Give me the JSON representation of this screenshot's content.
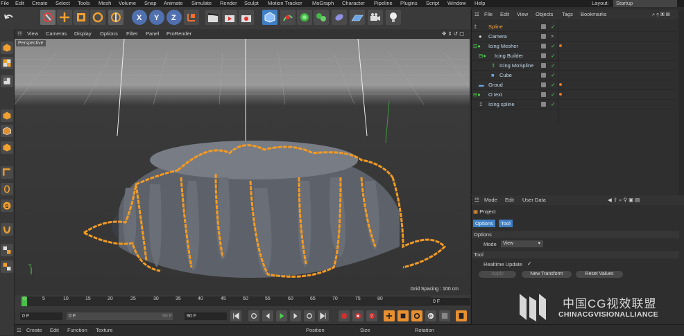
{
  "menubar": {
    "items": [
      "File",
      "Edit",
      "Create",
      "Select",
      "Tools",
      "Mesh",
      "Volume",
      "Snap",
      "Animate",
      "Simulate",
      "Render",
      "Sculpt",
      "Motion Tracker",
      "MoGraph",
      "Character",
      "Pipeline",
      "Plugins",
      "Script",
      "Window",
      "Help"
    ],
    "layout_label": "Layout:",
    "layout_value": "Startup"
  },
  "viewport": {
    "menu": [
      "View",
      "Cameras",
      "Display",
      "Options",
      "Filter",
      "Panel",
      "ProRender"
    ],
    "camera_label": "Perspective",
    "grid_spacing": "Grid Spacing : 100 cm",
    "axis_label": "Y"
  },
  "timeline": {
    "ticks": [
      "0",
      "5",
      "10",
      "15",
      "20",
      "25",
      "30",
      "35",
      "40",
      "45",
      "50",
      "55",
      "60",
      "65",
      "70",
      "75",
      "80"
    ],
    "current_frame": "0 F"
  },
  "playback": {
    "start_field": "0 F",
    "range_start": "0 F",
    "range_end": "90 F",
    "end_field": "90 F"
  },
  "bottom_left": {
    "menu": [
      "Create",
      "Edit",
      "Function",
      "Texture"
    ]
  },
  "coords": {
    "headers": [
      "Position",
      "Size",
      "Rotation"
    ]
  },
  "object_manager": {
    "menu": [
      "File",
      "Edit",
      "View",
      "Objects",
      "Tags",
      "Bookmarks"
    ],
    "objects": [
      {
        "name": "Spline",
        "indent": 0,
        "color": "#f0a040"
      },
      {
        "name": "Camera",
        "indent": 0,
        "color": "#c2d8ea"
      },
      {
        "name": "Icing Mesher",
        "indent": 0,
        "color": "#c2d8ea"
      },
      {
        "name": "Icing Builder",
        "indent": 1,
        "color": "#c2d8ea"
      },
      {
        "name": "Icing MoSpline",
        "indent": 2,
        "color": "#c2d8ea"
      },
      {
        "name": "Cube",
        "indent": 2,
        "color": "#c2d8ea"
      },
      {
        "name": "Groud",
        "indent": 0,
        "color": "#c2d8ea"
      },
      {
        "name": "O text",
        "indent": 0,
        "color": "#c2d8ea"
      },
      {
        "name": "Icing spline",
        "indent": 0,
        "color": "#c2d8ea"
      }
    ]
  },
  "attribute_manager": {
    "menu": [
      "Mode",
      "Edit",
      "User Data"
    ],
    "title": "Project",
    "tabs": [
      "Options",
      "Tool"
    ],
    "options_header": "Options",
    "mode_label": "Mode",
    "mode_value": "View",
    "tool_header": "Tool",
    "realtime_label": "Realtime Update",
    "realtime_checked": "✓",
    "buttons": [
      "Apply",
      "New Transform",
      "Reset Values"
    ]
  },
  "watermark": {
    "cn": "中国CG视效联盟",
    "en": "CHINACGVISIONALLIANCE"
  },
  "colors": {
    "accent_blue": "#3f7fc4",
    "spline_orange": "#f29b24",
    "check_green": "#4ccf4c"
  }
}
